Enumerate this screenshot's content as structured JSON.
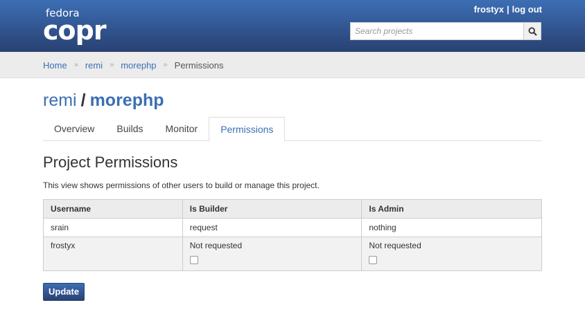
{
  "header": {
    "logo_top": "fedora",
    "logo_main": "copr",
    "user_name": "frostyx",
    "separator": "|",
    "logout_label": "log out",
    "search_placeholder": "Search projects",
    "search_icon": "search-icon",
    "bg_color": "#3c6eb4"
  },
  "breadcrumb": {
    "items": [
      "Home",
      "remi",
      "morephp"
    ],
    "current": "Permissions",
    "arrow": "»"
  },
  "project": {
    "owner": "remi",
    "slash": "/",
    "name": "morephp"
  },
  "tabs": [
    {
      "label": "Overview"
    },
    {
      "label": "Builds"
    },
    {
      "label": "Monitor"
    },
    {
      "label": "Permissions",
      "active": true
    }
  ],
  "section": {
    "title": "Project Permissions",
    "description": "This view shows permissions of other users to build or manage this project."
  },
  "table": {
    "headers": [
      "Username",
      "Is Builder",
      "Is Admin"
    ],
    "rows": [
      {
        "username": "srain",
        "builder": "request",
        "admin": "nothing"
      },
      {
        "username": "frostyx",
        "builder": "Not requested",
        "admin": "Not requested"
      }
    ]
  },
  "update_label": "Update",
  "colors": {
    "accent": "#3c6eb4",
    "header_dark": "#294172"
  }
}
